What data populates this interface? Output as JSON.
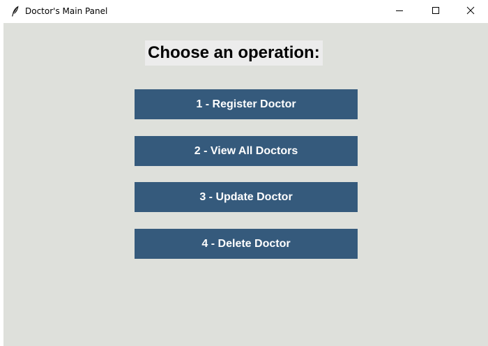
{
  "window": {
    "title": "Doctor's Main Panel",
    "app_icon": "feather-icon",
    "controls": {
      "minimize_icon": "minimize-icon",
      "maximize_icon": "maximize-icon",
      "close_icon": "close-icon"
    }
  },
  "panel": {
    "heading": "Choose an operation:",
    "buttons": [
      {
        "label": "1 - Register Doctor"
      },
      {
        "label": "2 - View All Doctors"
      },
      {
        "label": "3 - Update Doctor"
      },
      {
        "label": "4 - Delete Doctor"
      }
    ]
  },
  "colors": {
    "background": "#dee0db",
    "button": "#355a7c",
    "button_text": "#ffffff",
    "heading_bg": "#ececec"
  }
}
